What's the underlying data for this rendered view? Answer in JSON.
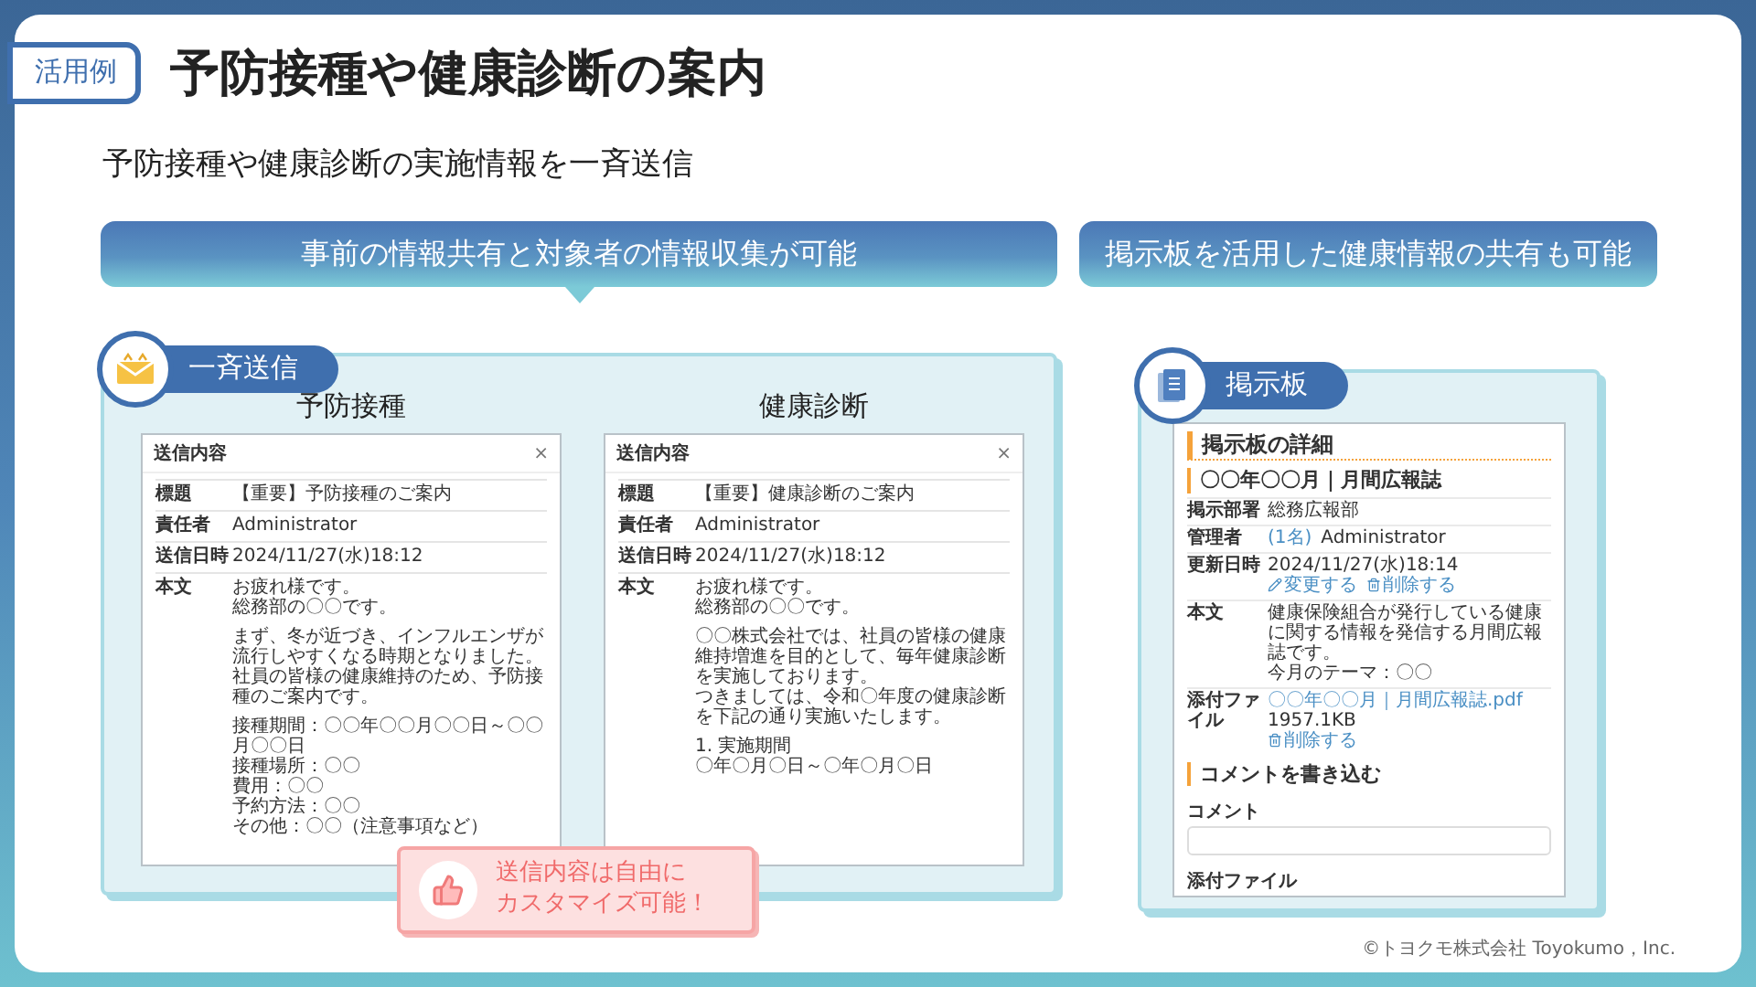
{
  "tag": "活用例",
  "title": "予防接種や健康診断の案内",
  "subtitle": "予防接種や健康診断の実施情報を一斉送信",
  "broadcast": {
    "banner": "事前の情報共有と対象者の情報収集が可能",
    "badge": "一斉送信",
    "messages": [
      {
        "heading": "予防接種",
        "window_title": "送信内容",
        "close": "×",
        "fields": [
          {
            "label": "標題",
            "value": "【重要】予防接種のご案内"
          },
          {
            "label": "責任者",
            "value": "Administrator"
          },
          {
            "label": "送信日時",
            "value": "2024/11/27(水)18:12"
          }
        ],
        "body_label": "本文",
        "body": [
          [
            "お疲れ様です。",
            "総務部の〇〇です。"
          ],
          [
            "まず、冬が近づき、インフルエンザが流行しやすくなる時期となりました。",
            "社員の皆様の健康維持のため、予防接種のご案内です。"
          ],
          [
            "接種期間：〇〇年〇〇月〇〇日～〇〇月〇〇日",
            "接種場所：〇〇",
            "費用：〇〇",
            "予約方法：〇〇",
            "その他：〇〇（注意事項など）"
          ]
        ]
      },
      {
        "heading": "健康診断",
        "window_title": "送信内容",
        "close": "×",
        "fields": [
          {
            "label": "標題",
            "value": "【重要】健康診断のご案内"
          },
          {
            "label": "責任者",
            "value": "Administrator"
          },
          {
            "label": "送信日時",
            "value": "2024/11/27(水)18:12"
          }
        ],
        "body_label": "本文",
        "body": [
          [
            "お疲れ様です。",
            "総務部の〇〇です。"
          ],
          [
            "〇〇株式会社では、社員の皆様の健康維持増進を目的として、毎年健康診断を実施しております。",
            "つきましては、令和〇年度の健康診断を下記の通り実施いたします。"
          ],
          [
            "1. 実施期間",
            "〇年〇月〇日～〇年〇月〇日"
          ]
        ]
      }
    ],
    "callout": [
      "送信内容は自由に",
      "カスタマイズ可能！"
    ]
  },
  "bulletin": {
    "banner": "掲示板を活用した健康情報の共有も可能",
    "badge": "掲示板",
    "board": {
      "title": "掲示板の詳細",
      "subtitle": "〇〇年〇〇月｜月間広報誌",
      "rows": [
        {
          "label": "掲示部署",
          "lines": [
            [
              {
                "kind": "text",
                "text": "総務広報部"
              }
            ]
          ]
        },
        {
          "label": "管理者",
          "lines": [
            [
              {
                "kind": "link",
                "text": "(1名)"
              },
              {
                "kind": "text",
                "text": "Administrator"
              }
            ]
          ]
        },
        {
          "label": "更新日時",
          "lines": [
            [
              {
                "kind": "text",
                "text": "2024/11/27(水)18:14"
              },
              {
                "kind": "edit",
                "text": "変更する"
              },
              {
                "kind": "delete",
                "text": "削除する"
              }
            ]
          ]
        },
        {
          "label": "本文",
          "lines": [
            [
              {
                "kind": "text",
                "text": "健康保険組合が発行している健康に関する情報を発信する月間広報誌です。"
              }
            ],
            [
              {
                "kind": "text",
                "text": "今月のテーマ：〇〇"
              }
            ]
          ]
        },
        {
          "label": "添付ファイル",
          "lines": [
            [
              {
                "kind": "link",
                "text": "〇〇年〇〇月｜月間広報誌.pdf"
              },
              {
                "kind": "text",
                "text": "1957.1KB"
              }
            ],
            [
              {
                "kind": "delete",
                "text": "削除する"
              }
            ]
          ]
        }
      ],
      "comment_heading": "コメントを書き込む",
      "comment_label": "コメント",
      "attach_label": "添付ファイル"
    }
  },
  "copyright": "©トヨクモ株式会社 Toyokumo，Inc."
}
